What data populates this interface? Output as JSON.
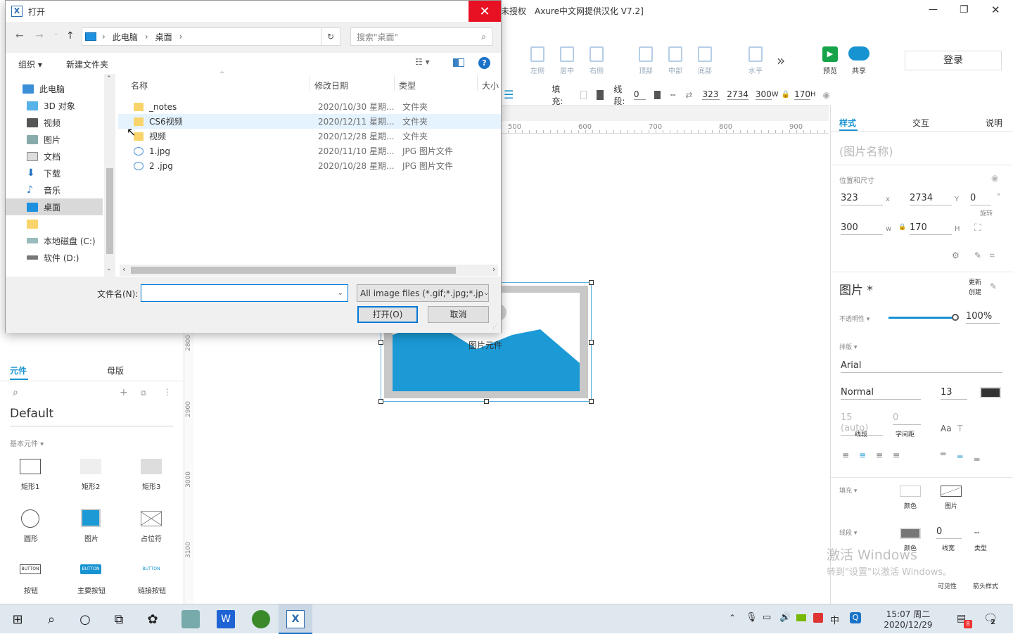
{
  "app": {
    "title": "未授权　Axure中文网提供汉化 V7.2]",
    "min": "—",
    "max": "❐",
    "close": "✕"
  },
  "toolbar": {
    "items": [
      "左侧",
      "居中",
      "右侧",
      "顶部",
      "中部",
      "底部",
      "水平"
    ],
    "more": "»",
    "preview": "预览",
    "share": "共享",
    "login": "登录"
  },
  "propbar": {
    "fill_label": "填充:",
    "stroke_label": "线段:",
    "stroke_val": "0",
    "x": "323",
    "y": "2734",
    "w_label": "W",
    "w": "300",
    "h": "170",
    "h_label": "H"
  },
  "ruler": {
    "ticks": [
      "500",
      "600",
      "700",
      "800",
      "900"
    ],
    "vticks": [
      "2800",
      "2900",
      "3000",
      "3100"
    ]
  },
  "image_widget": {
    "label": "图片元件"
  },
  "left": {
    "tab_widgets": "元件",
    "tab_masters": "母版",
    "library": "Default",
    "group": "基本元件 ▾",
    "widgets": [
      "矩形1",
      "矩形2",
      "矩形3",
      "圆形",
      "图片",
      "占位符",
      "按钮",
      "主要按钮",
      "链接按钮"
    ],
    "btn_text": "BUTTON"
  },
  "right": {
    "tabs": [
      "样式",
      "交互",
      "说明"
    ],
    "name_placeholder": "(图片名称)",
    "pos_label": "位置和尺寸",
    "x": "323",
    "x_label": "x",
    "y": "2734",
    "y_label": "Y",
    "rot": "0",
    "rot_unit": "°",
    "rot_label": "旋转",
    "w": "300",
    "w_label": "w",
    "h": "170",
    "h_label": "H",
    "section": "图片 *",
    "refresh": "更新",
    "create": "创建",
    "opacity_label": "不透明性 ▾",
    "opacity": "100%",
    "font_label": "排版 ▾",
    "font": "Arial",
    "weight": "Normal",
    "size": "13",
    "line_ph": "15 (auto)",
    "line_label": "线段",
    "char_ph": "0",
    "char_label": "字间距",
    "fill_label": "填充 ▾",
    "fill_color": "颜色",
    "fill_img": "图片",
    "stroke_label": "线段 ▾",
    "stroke_color": "颜色",
    "stroke_w": "0",
    "stroke_w_label": "线宽",
    "stroke_type": "类型",
    "visible": "可见性",
    "arrow": "箭头样式",
    "watermark1": "激活 Windows",
    "watermark2": "转到\"设置\"以激活 Windows。"
  },
  "dialog": {
    "title": "打开",
    "close": "✕",
    "path": [
      "此电脑",
      "桌面"
    ],
    "search_ph": "搜索\"桌面\"",
    "organize": "组织 ▾",
    "newfolder": "新建文件夹",
    "nav": [
      "此电脑",
      "3D 对象",
      "视频",
      "图片",
      "文档",
      "下载",
      "音乐",
      "桌面",
      "",
      "本地磁盘 (C:)",
      "软件 (D:)"
    ],
    "columns": [
      "名称",
      "修改日期",
      "类型",
      "大小"
    ],
    "files": [
      {
        "name": "_notes",
        "date": "2020/10/30 星期...",
        "type": "文件夹",
        "kind": "folder"
      },
      {
        "name": "CS6视频",
        "date": "2020/12/11 星期...",
        "type": "文件夹",
        "kind": "folder"
      },
      {
        "name": "视频",
        "date": "2020/12/28 星期...",
        "type": "文件夹",
        "kind": "folder"
      },
      {
        "name": "1.jpg",
        "date": "2020/11/10 星期...",
        "type": "JPG 图片文件",
        "kind": "jpg"
      },
      {
        "name": "2 .jpg",
        "date": "2020/10/28 星期...",
        "type": "JPG 图片文件",
        "kind": "jpg"
      }
    ],
    "filename_label": "文件名(N):",
    "filename": "",
    "filter": "All image files (*.gif;*.jpg;*.jp",
    "open": "打开(O)",
    "cancel": "取消"
  },
  "taskbar": {
    "time": "15:07 周二",
    "date": "2020/12/29",
    "ime": "中",
    "notif": "2",
    "badge": "8"
  },
  "colors": {
    "accent": "#1893d1",
    "close_red": "#e81123",
    "image_blue": "#1b9ad6"
  }
}
